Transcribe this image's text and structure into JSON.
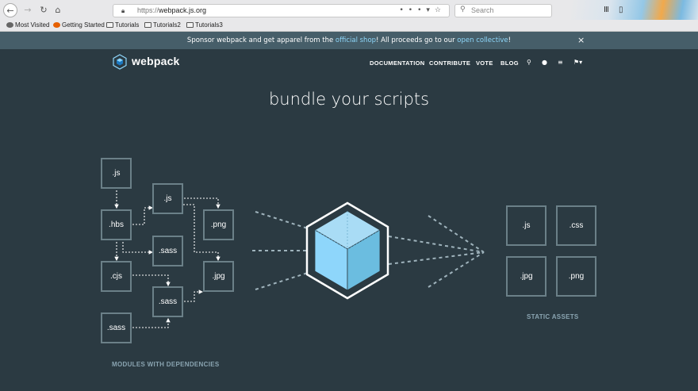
{
  "browser": {
    "url_prefix": "https://",
    "url_domain": "webpack.js.org",
    "search_placeholder": "Search",
    "bookmarks": [
      "Most Visited",
      "Getting Started",
      "Tutorials",
      "Tutorials2",
      "Tutorials3"
    ]
  },
  "banner": {
    "text_before": "Sponsor webpack and get apparel from the ",
    "shop_link": "official shop",
    "text_middle": "! All proceeds go to our ",
    "collective_link": "open collective",
    "text_after": "!",
    "close_glyph": "×"
  },
  "header": {
    "logo_text": "webpack",
    "nav": [
      "DOCUMENTATION",
      "CONTRIBUTE",
      "VOTE",
      "BLOG"
    ]
  },
  "hero": {
    "headline": "bundle your scripts"
  },
  "diagram": {
    "modules": [
      ".js",
      ".js",
      ".hbs",
      ".png",
      ".sass",
      ".cjs",
      ".jpg",
      ".sass",
      ".sass"
    ],
    "modules_caption": "MODULES WITH DEPENDENCIES",
    "assets": [
      ".js",
      ".css",
      ".jpg",
      ".png"
    ],
    "assets_caption": "STATIC ASSETS"
  },
  "colors": {
    "page_bg": "#2b3a42",
    "banner_bg": "#465e69",
    "link": "#8dd6f9",
    "cube_face": "#8ed6fb",
    "node_border": "#6b8088"
  }
}
